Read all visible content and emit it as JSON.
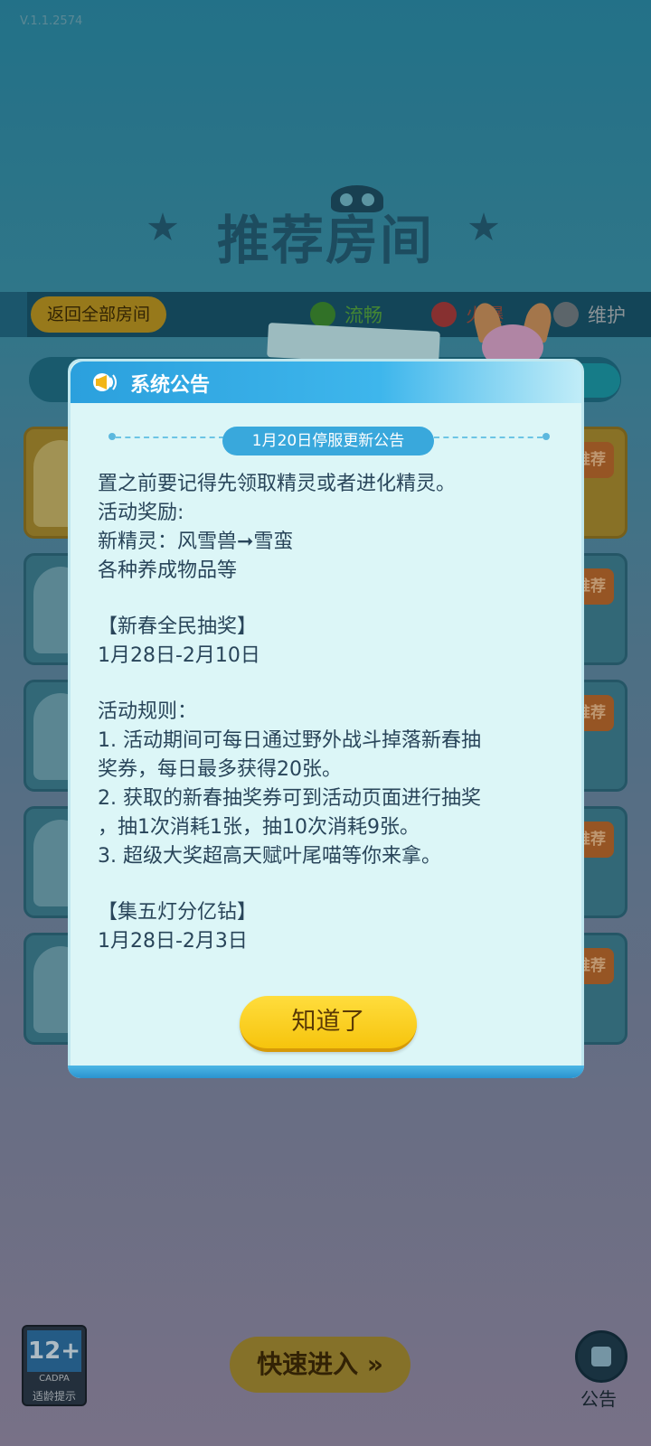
{
  "app": {
    "version": "V.1.1.2574"
  },
  "lobby": {
    "title": "推荐房间",
    "back_button": "返回全部房间",
    "status_legend": [
      {
        "label": "流畅",
        "color": "#53a43f"
      },
      {
        "label": "火爆",
        "color": "#a53b3b"
      },
      {
        "label": "维护",
        "color": "#a9b3b8"
      }
    ],
    "recommend_badge": "推荐",
    "quick_enter": "快速进入 »",
    "notice_label": "公告",
    "age_rating": {
      "number": "12+",
      "org": "CADPA",
      "tip": "适龄提示"
    }
  },
  "dialog": {
    "title": "系统公告",
    "subtitle": "1月20日停服更新公告",
    "lines": [
      "置之前要记得先领取精灵或者进化精灵。",
      "活动奖励:",
      "新精灵：风雪兽➞雪蛮",
      "各种养成物品等",
      "",
      "【新春全民抽奖】",
      "1月28日-2月10日",
      "",
      "活动规则：",
      "1. 活动期间可每日通过野外战斗掉落新春抽",
      "奖券，每日最多获得20张。",
      "2. 获取的新春抽奖券可到活动页面进行抽奖",
      "，抽1次消耗1张，抽10次消耗9张。",
      "3. 超级大奖超高天赋叶尾喵等你来拿。",
      "",
      "【集五灯分亿钻】",
      "1月28日-2月3日"
    ],
    "ok_button": "知道了"
  },
  "colors": {
    "dialog_header": "#2ba0dd",
    "dialog_body": "#dcf6f7",
    "ok_button": "#f6c40d",
    "text": "#29455a"
  }
}
